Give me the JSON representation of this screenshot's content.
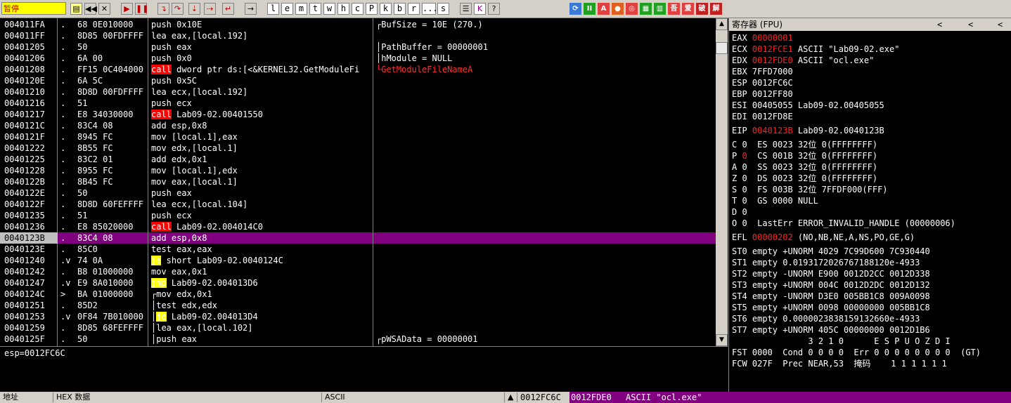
{
  "toolbar": {
    "status_label": "暂停",
    "letters": [
      "l",
      "e",
      "m",
      "t",
      "w",
      "h",
      "c",
      "P",
      "k",
      "b",
      "r",
      "...",
      "s"
    ]
  },
  "cpu": {
    "rows": [
      {
        "addr": "004011FA",
        "mark": ".",
        "hex": "68 0E010000",
        "disp": [
          {
            "t": "push",
            "c": "push"
          },
          {
            "t": " 0x10E",
            "c": "imm"
          }
        ],
        "cmt": "┌BufSize = 10E (270.)",
        "cc": "cmt"
      },
      {
        "addr": "004011FF",
        "mark": ".",
        "hex": "8D85 00FDFFFF",
        "disp": [
          {
            "t": "lea eax,[local.192]",
            "c": "lea"
          }
        ],
        "cmt": "",
        "cc": "cmt"
      },
      {
        "addr": "00401205",
        "mark": ".",
        "hex": "50",
        "disp": [
          {
            "t": "push eax",
            "c": "push"
          }
        ],
        "cmt": "│PathBuffer = 00000001",
        "cc": "cmt"
      },
      {
        "addr": "00401206",
        "mark": ".",
        "hex": "6A 00",
        "disp": [
          {
            "t": "push",
            "c": "push"
          },
          {
            "t": " 0x0",
            "c": "imm"
          }
        ],
        "cmt": "│hModule = NULL",
        "cc": "cmt"
      },
      {
        "addr": "00401208",
        "mark": ".",
        "hex": "FF15 0C404000",
        "disp": [
          {
            "t": "call",
            "c": "call"
          },
          {
            "t": " dword ptr ds:[<&KERNEL32.GetModuleFi",
            "c": "calltext"
          }
        ],
        "cmt": "└GetModuleFileNameA",
        "cc": "cmtred"
      },
      {
        "addr": "0040120E",
        "mark": ".",
        "hex": "6A 5C",
        "disp": [
          {
            "t": "push",
            "c": "push"
          },
          {
            "t": " 0x5C",
            "c": "imm"
          }
        ],
        "cmt": "",
        "cc": "cmt"
      },
      {
        "addr": "00401210",
        "mark": ".",
        "hex": "8D8D 00FDFFFF",
        "disp": [
          {
            "t": "lea ecx,[local.192]",
            "c": "lea"
          }
        ],
        "cmt": "",
        "cc": "cmt"
      },
      {
        "addr": "00401216",
        "mark": ".",
        "hex": "51",
        "disp": [
          {
            "t": "push ecx",
            "c": "push"
          }
        ],
        "cmt": "",
        "cc": "cmt"
      },
      {
        "addr": "00401217",
        "mark": ".",
        "hex": "E8 34030000",
        "disp": [
          {
            "t": "call",
            "c": "call"
          },
          {
            "t": " Lab09-02.00401550",
            "c": "cmt"
          }
        ],
        "cmt": "",
        "cc": "cmt"
      },
      {
        "addr": "0040121C",
        "mark": ".",
        "hex": "83C4 08",
        "disp": [
          {
            "t": "add esp,",
            "c": "add"
          },
          {
            "t": "0x8",
            "c": "imm"
          }
        ],
        "cmt": "",
        "cc": "cmt"
      },
      {
        "addr": "0040121F",
        "mark": ".",
        "hex": "8945 FC",
        "disp": [
          {
            "t": "mov [local.1],eax",
            "c": "mov"
          }
        ],
        "cmt": "",
        "cc": "cmt"
      },
      {
        "addr": "00401222",
        "mark": ".",
        "hex": "8B55 FC",
        "disp": [
          {
            "t": "mov edx,[local.1]",
            "c": "mov"
          }
        ],
        "cmt": "",
        "cc": "cmt"
      },
      {
        "addr": "00401225",
        "mark": ".",
        "hex": "83C2 01",
        "disp": [
          {
            "t": "add edx,",
            "c": "add"
          },
          {
            "t": "0x1",
            "c": "imm"
          }
        ],
        "cmt": "",
        "cc": "cmt"
      },
      {
        "addr": "00401228",
        "mark": ".",
        "hex": "8955 FC",
        "disp": [
          {
            "t": "mov [local.1],edx",
            "c": "mov"
          }
        ],
        "cmt": "",
        "cc": "cmt"
      },
      {
        "addr": "0040122B",
        "mark": ".",
        "hex": "8B45 FC",
        "disp": [
          {
            "t": "mov eax,[local.1]",
            "c": "mov"
          }
        ],
        "cmt": "",
        "cc": "cmt"
      },
      {
        "addr": "0040122E",
        "mark": ".",
        "hex": "50",
        "disp": [
          {
            "t": "push eax",
            "c": "push"
          }
        ],
        "cmt": "",
        "cc": "cmt"
      },
      {
        "addr": "0040122F",
        "mark": ".",
        "hex": "8D8D 60FEFFFF",
        "disp": [
          {
            "t": "lea ecx,[local.104]",
            "c": "lea"
          }
        ],
        "cmt": "",
        "cc": "cmt"
      },
      {
        "addr": "00401235",
        "mark": ".",
        "hex": "51",
        "disp": [
          {
            "t": "push ecx",
            "c": "push"
          }
        ],
        "cmt": "",
        "cc": "cmt"
      },
      {
        "addr": "00401236",
        "mark": ".",
        "hex": "E8 85020000",
        "disp": [
          {
            "t": "call",
            "c": "call"
          },
          {
            "t": " Lab09-02.004014C0",
            "c": "cmt"
          }
        ],
        "cmt": "",
        "cc": "cmt"
      },
      {
        "addr": "0040123B",
        "mark": ".",
        "hex": "83C4 08",
        "disp": [
          {
            "t": "add esp,",
            "c": "add"
          },
          {
            "t": "0x8",
            "c": "imm"
          }
        ],
        "cmt": "",
        "cc": "cmt",
        "sel": true
      },
      {
        "addr": "0040123E",
        "mark": ".",
        "hex": "85C0",
        "disp": [
          {
            "t": "test eax,eax",
            "c": "test"
          }
        ],
        "cmt": "",
        "cc": "cmt"
      },
      {
        "addr": "00401240",
        "mark": ".v",
        "hex": "74 0A",
        "disp": [
          {
            "t": "je",
            "c": "jcc"
          },
          {
            "t": " short Lab09-02.0040124C",
            "c": "cmt"
          }
        ],
        "cmt": "",
        "cc": "cmt"
      },
      {
        "addr": "00401242",
        "mark": ".",
        "hex": "B8 01000000",
        "disp": [
          {
            "t": "mov eax,",
            "c": "mov"
          },
          {
            "t": "0x1",
            "c": "imm"
          }
        ],
        "cmt": "",
        "cc": "cmt"
      },
      {
        "addr": "00401247",
        "mark": ".v",
        "hex": "E9 8A010000",
        "disp": [
          {
            "t": "jmp",
            "c": "jcc"
          },
          {
            "t": " Lab09-02.004013D6",
            "c": "cmt"
          }
        ],
        "cmt": "",
        "cc": "cmt"
      },
      {
        "addr": "0040124C",
        "mark": ">",
        "hex": "BA 01000000",
        "disp": [
          {
            "t": "┌mov edx,",
            "c": "mov"
          },
          {
            "t": "0x1",
            "c": "imm"
          }
        ],
        "cmt": "",
        "cc": "cmt"
      },
      {
        "addr": "00401251",
        "mark": ".",
        "hex": "85D2",
        "disp": [
          {
            "t": "│test edx,edx",
            "c": "test"
          }
        ],
        "cmt": "",
        "cc": "cmt"
      },
      {
        "addr": "00401253",
        "mark": ".v",
        "hex": "0F84 7B010000",
        "disp": [
          {
            "t": "│",
            "c": "cmt"
          },
          {
            "t": "je",
            "c": "jcc"
          },
          {
            "t": " Lab09-02.004013D4",
            "c": "cmt"
          }
        ],
        "cmt": "",
        "cc": "cmt"
      },
      {
        "addr": "00401259",
        "mark": ".",
        "hex": "8D85 68FEFFFF",
        "disp": [
          {
            "t": "│lea eax,[local.102]",
            "c": "lea"
          }
        ],
        "cmt": "",
        "cc": "cmt"
      },
      {
        "addr": "0040125F",
        "mark": ".",
        "hex": "50",
        "disp": [
          {
            "t": "│push eax",
            "c": "push"
          }
        ],
        "cmt": "┌pWSAData = 00000001",
        "cc": "cmt"
      }
    ]
  },
  "info": {
    "text": "esp=0012FC6C"
  },
  "registers": {
    "title": "寄存器 (FPU)",
    "nav": [
      "<",
      "<",
      "<"
    ],
    "lines": [
      {
        "parts": [
          {
            "t": "EAX "
          },
          {
            "t": "00000001",
            "c": "red"
          }
        ]
      },
      {
        "parts": [
          {
            "t": "ECX "
          },
          {
            "t": "0012FCE1",
            "c": "red"
          },
          {
            "t": " ASCII \"Lab09-02.exe\""
          }
        ]
      },
      {
        "parts": [
          {
            "t": "EDX "
          },
          {
            "t": "0012FDE0",
            "c": "red"
          },
          {
            "t": " ASCII \"ocl.exe\""
          }
        ]
      },
      {
        "parts": [
          {
            "t": "EBX 7FFD7000"
          }
        ]
      },
      {
        "parts": [
          {
            "t": "ESP 0012FC6C"
          }
        ]
      },
      {
        "parts": [
          {
            "t": "EBP 0012FF80"
          }
        ]
      },
      {
        "parts": [
          {
            "t": "ESI 00405055 Lab09-02.00405055"
          }
        ]
      },
      {
        "parts": [
          {
            "t": "EDI 0012FD8E"
          }
        ]
      },
      {
        "gap": true
      },
      {
        "parts": [
          {
            "t": "EIP "
          },
          {
            "t": "0040123B",
            "c": "red"
          },
          {
            "t": " Lab09-02.0040123B"
          }
        ]
      },
      {
        "gap": true
      },
      {
        "parts": [
          {
            "t": "C 0  ES 0023 32位 0(FFFFFFFF)"
          }
        ]
      },
      {
        "parts": [
          {
            "t": "P "
          },
          {
            "t": "0",
            "c": "red"
          },
          {
            "t": "  CS 001B 32位 0(FFFFFFFF)"
          }
        ]
      },
      {
        "parts": [
          {
            "t": "A 0  SS 0023 32位 0(FFFFFFFF)"
          }
        ]
      },
      {
        "parts": [
          {
            "t": "Z 0  DS 0023 32位 0(FFFFFFFF)"
          }
        ]
      },
      {
        "parts": [
          {
            "t": "S 0  FS 003B 32位 7FFDF000(FFF)"
          }
        ]
      },
      {
        "parts": [
          {
            "t": "T 0  GS 0000 NULL"
          }
        ]
      },
      {
        "parts": [
          {
            "t": "D 0"
          }
        ]
      },
      {
        "parts": [
          {
            "t": "O 0  LastErr ERROR_INVALID_HANDLE (00000006)"
          }
        ]
      },
      {
        "gap": true
      },
      {
        "parts": [
          {
            "t": "EFL "
          },
          {
            "t": "00000202",
            "c": "red"
          },
          {
            "t": " (NO,NB,NE,A,NS,PO,GE,G)"
          }
        ]
      },
      {
        "gap": true
      },
      {
        "parts": [
          {
            "t": "ST0 empty +UNORM 4029 7C99D600 7C930440"
          }
        ]
      },
      {
        "parts": [
          {
            "t": "ST1 empty 0.0193172026767188120e-4933"
          }
        ]
      },
      {
        "parts": [
          {
            "t": "ST2 empty -UNORM E900 0012D2CC 0012D338"
          }
        ]
      },
      {
        "parts": [
          {
            "t": "ST3 empty +UNORM 004C 0012D2DC 0012D132"
          }
        ]
      },
      {
        "parts": [
          {
            "t": "ST4 empty -UNORM D3E0 005BB1C8 009A0098"
          }
        ]
      },
      {
        "parts": [
          {
            "t": "ST5 empty +UNORM 0098 00000000 005BB1C8"
          }
        ]
      },
      {
        "parts": [
          {
            "t": "ST6 empty 0.0000023838159132660e-4933"
          }
        ]
      },
      {
        "parts": [
          {
            "t": "ST7 empty +UNORM 405C 00000000 0012D1B6"
          }
        ]
      },
      {
        "parts": [
          {
            "t": "               3 2 1 0      E S P U O Z D I"
          }
        ]
      },
      {
        "parts": [
          {
            "t": "FST 0000  Cond 0 0 0 0  Err 0 0 0 0 0 0 0 0  (GT)"
          }
        ]
      },
      {
        "parts": [
          {
            "t": "FCW 027F  Prec NEAR,53  掩码    1 1 1 1 1 1"
          }
        ]
      }
    ]
  },
  "bottom": {
    "addr_label": "地址",
    "hex_label": "HEX 数据",
    "ascii_label": "ASCII",
    "stack_addr": "0012FC6C",
    "stack_val": "0012FDE0",
    "stack_cmt": "ASCII \"ocl.exe\""
  }
}
